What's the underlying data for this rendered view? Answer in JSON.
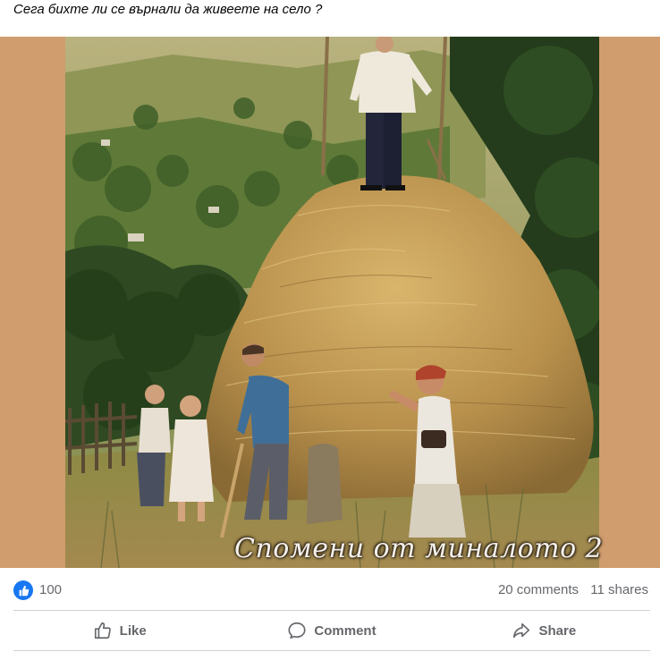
{
  "post": {
    "text": "Сега бихте ли се върнали да живеете на село ?"
  },
  "photo": {
    "caption": "Спомени от миналото 2",
    "frame_color": "#cf9d6e"
  },
  "reactions": {
    "icon": "like-icon",
    "count": "100",
    "comments": "20 comments",
    "shares": "11 shares",
    "accent": "#1877f2"
  },
  "actions": {
    "like": {
      "label": "Like",
      "icon": "thumbs-up-icon"
    },
    "comment": {
      "label": "Comment",
      "icon": "speech-bubble-icon"
    },
    "share": {
      "label": "Share",
      "icon": "share-arrow-icon"
    }
  }
}
